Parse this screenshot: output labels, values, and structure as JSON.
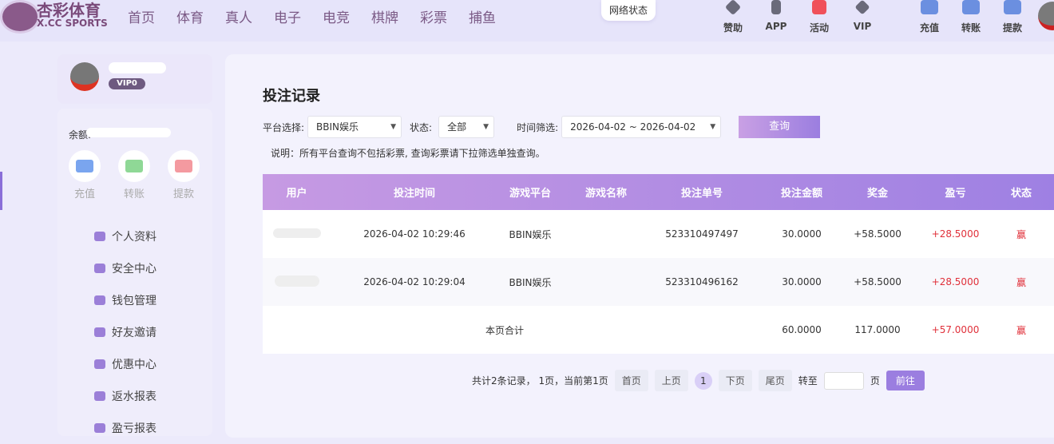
{
  "header": {
    "brand": "杏彩体育",
    "brand_sub": "X.CC SPORTS",
    "nav": [
      "首页",
      "体育",
      "真人",
      "电子",
      "电竞",
      "棋牌",
      "彩票",
      "捕鱼"
    ],
    "network": "网络状态",
    "tools": [
      "赞助",
      "APP",
      "活动",
      "VIP"
    ],
    "wallet": [
      "充值",
      "转账",
      "提款"
    ]
  },
  "sidebar": {
    "vip": "VIP0",
    "balance_label": "余额:",
    "actions": [
      "充值",
      "转账",
      "提款"
    ],
    "menu": [
      "个人资料",
      "安全中心",
      "钱包管理",
      "好友邀请",
      "优惠中心",
      "返水报表",
      "盈亏报表"
    ]
  },
  "main": {
    "title": "投注记录",
    "platform_label": "平台选择:",
    "platform": "BBIN娱乐",
    "status_label": "状态:",
    "status": "全部",
    "time_label": "时间筛选:",
    "date_range": "2026-04-02 ~ 2026-04-02",
    "query": "查询",
    "note": "说明：所有平台查询不包括彩票, 查询彩票请下拉筛选单独查询。",
    "columns": [
      "用户",
      "投注时间",
      "游戏平台",
      "游戏名称",
      "投注单号",
      "投注金额",
      "奖金",
      "盈亏",
      "状态"
    ],
    "rows": [
      {
        "user": "",
        "time": "2026-04-02 10:29:46",
        "platform": "BBIN娱乐",
        "game": "",
        "order": "523310497497",
        "amount": "30.0000",
        "bonus": "+58.5000",
        "profit": "+28.5000",
        "status": "赢"
      },
      {
        "user": "",
        "time": "2026-04-02 10:29:04",
        "platform": "BBIN娱乐",
        "game": "",
        "order": "523310496162",
        "amount": "30.0000",
        "bonus": "+58.5000",
        "profit": "+28.5000",
        "status": "赢"
      }
    ],
    "total": {
      "label": "本页合计",
      "amount": "60.0000",
      "bonus": "117.0000",
      "profit": "+57.0000",
      "status": "赢"
    },
    "pager": {
      "summary": "共计2条记录， 1页，当前第1页",
      "first": "首页",
      "prev": "上页",
      "current": "1",
      "next": "下页",
      "last": "尾页",
      "goto": "转至",
      "page": "页",
      "go": "前往"
    }
  }
}
